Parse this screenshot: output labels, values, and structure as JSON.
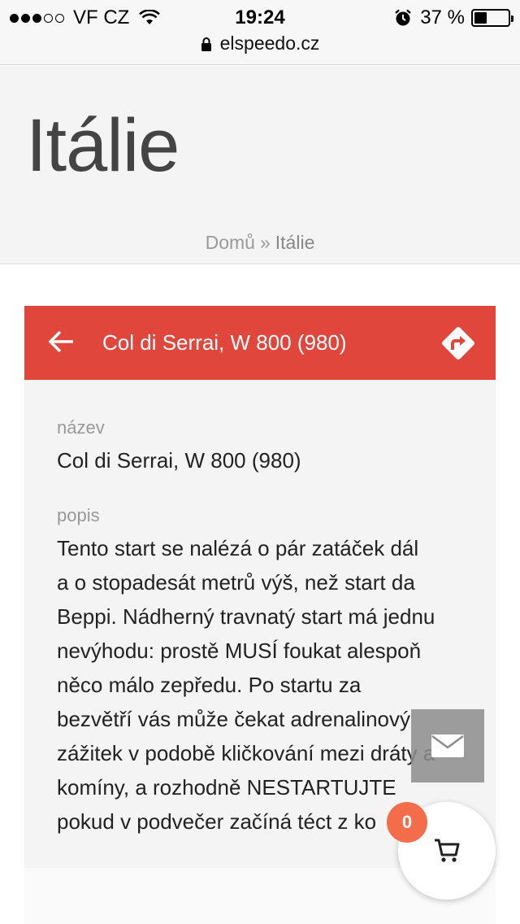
{
  "status_bar": {
    "carrier": "VF CZ",
    "signal_bars_filled": 3,
    "signal_bars_total": 5,
    "time": "19:24",
    "battery_text": "37 %",
    "battery_level": 0.37,
    "icons": [
      "wifi-icon",
      "alarm-icon",
      "battery-icon"
    ]
  },
  "browser": {
    "url": "elspeedo.cz",
    "icons": [
      "lock-icon"
    ]
  },
  "page": {
    "title": "Itálie",
    "breadcrumb": {
      "home": "Domů",
      "separator": "»",
      "current": "Itálie"
    }
  },
  "card": {
    "header_title": "Col di Serrai, W 800 (980)",
    "header_color": "#e0463b",
    "icons": [
      "back-arrow-icon",
      "directions-icon"
    ],
    "name_label": "název",
    "name_value": "Col di Serrai, W 800 (980)",
    "desc_label": "popis",
    "desc_lines": [
      "Tento start se nalézá o pár zatáček dál",
      "a o stopadesát metrů výš, než start da",
      "Beppi. Nádherný travnatý start má jednu",
      "nevýhodu: prostě MUSÍ foukat alespoň",
      "něco málo zepředu. Po startu za",
      "bezvětří vás může čekat adrenalinový",
      "zážitek v podobě kličkování mezi dráty a",
      "komíny, a rozhodně NESTARTUJTE",
      "pokud v podvečer začíná téct z ko"
    ]
  },
  "floating": {
    "mail_icon": "mail-icon",
    "cart_icon": "cart-icon",
    "cart_count": "0",
    "badge_color": "#f36d4a"
  }
}
